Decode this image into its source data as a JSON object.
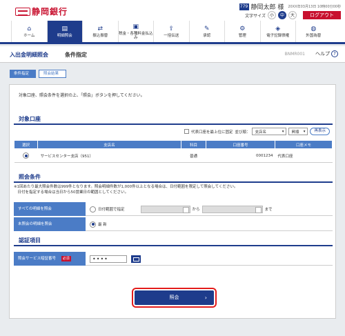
{
  "header": {
    "bank_name": "静岡銀行",
    "user_badge": "779",
    "user_name": "静岡太郎 様",
    "timestamp": "20XX年03月13日 10時00分00秒",
    "text_size_label": "文字サイズ",
    "text_sizes": [
      "小",
      "中",
      "大"
    ],
    "logout_label": "ログアウト"
  },
  "nav": {
    "items": [
      {
        "label": "ホーム",
        "icon": "home-icon"
      },
      {
        "label": "明細照会",
        "icon": "document-icon"
      },
      {
        "label": "振込振替",
        "icon": "transfer-icon"
      },
      {
        "label": "税金・各種料金払込み",
        "icon": "payment-icon"
      },
      {
        "label": "一括伝送",
        "icon": "upload-icon"
      },
      {
        "label": "承認",
        "icon": "approve-icon"
      },
      {
        "label": "管理",
        "icon": "gear-icon"
      },
      {
        "label": "電子記録債権",
        "icon": "ebond-icon"
      },
      {
        "label": "外国為替",
        "icon": "globe-icon"
      }
    ]
  },
  "page": {
    "title": "入出金明細照会",
    "subtitle": "条件指定",
    "code": "BNMR001",
    "help_label": "ヘルプ"
  },
  "steps": [
    "条件指定",
    "照会結果"
  ],
  "intro": "対象口座、照会条件を選択の上、「照会」ボタンを押してください。",
  "accounts": {
    "section_title": "対象口座",
    "representative_top_label": "代表口座を最上位に固定",
    "sort_label": "並び順：",
    "sort_value": "支店名",
    "order_value": "昇順",
    "redisplay_label": "再表示",
    "columns": [
      "選択",
      "支店名",
      "科目",
      "口座番号",
      "口座メモ"
    ],
    "rows": [
      {
        "branch": "サービスセンター支店（951）",
        "subject": "普通",
        "number": "0001234",
        "memo": "代表口座"
      }
    ]
  },
  "conditions": {
    "section_title": "照会条件",
    "note_line1": "※1回あたり最大照会件数は999件となります。照会明細件数が1,000件以上となる場合は、日付範囲を限定して照会してください。",
    "note_line2": "　日付を指定する場合は当日から50営業日の範囲としてください。",
    "all_label": "すべての明細を照会",
    "date_range_label": "日付範囲で指定",
    "from_label": "から",
    "to_label": "まで",
    "unread_label": "未照会の明細を照会",
    "latest_label": "最 新"
  },
  "auth": {
    "section_title": "認証項目",
    "pin_label": "照会サービス暗証番号",
    "required_label": "必須",
    "pin_value": "••••"
  },
  "action": {
    "query_label": "照会"
  }
}
